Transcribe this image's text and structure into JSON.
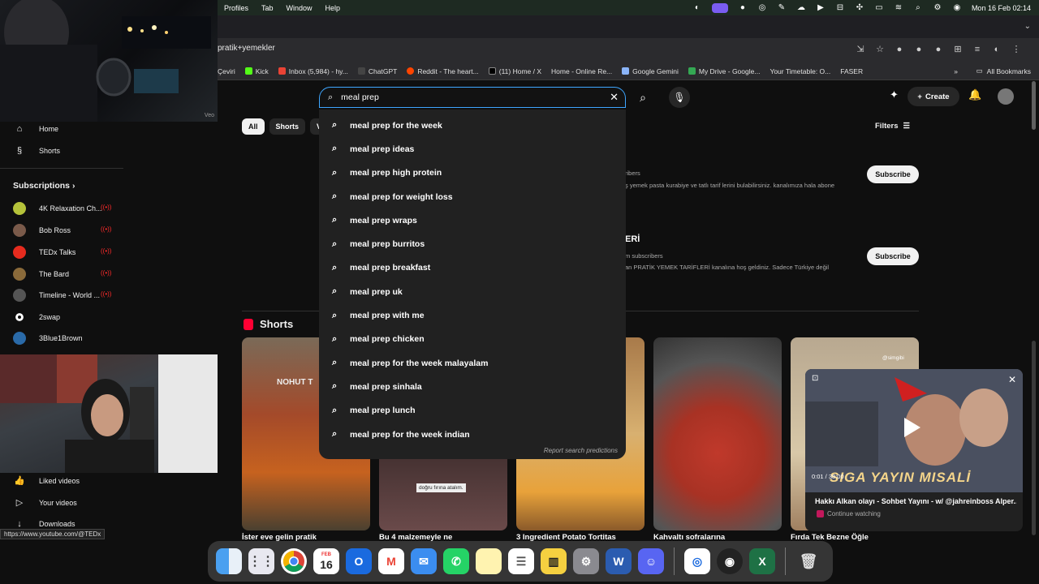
{
  "menubar": {
    "menus": [
      "Profiles",
      "Tab",
      "Window",
      "Help"
    ],
    "clock": "Mon 16 Feb  02:14"
  },
  "browser": {
    "url_fragment": "pratik+yemekler",
    "bookmarks": [
      {
        "label": "Çeviri",
        "color": "#4a8af4"
      },
      {
        "label": "Kick",
        "color": "#53fc18"
      },
      {
        "label": "Inbox (5,984) - hy...",
        "color": "#ea4335"
      },
      {
        "label": "ChatGPT",
        "color": "#444444"
      },
      {
        "label": "Reddit - The heart...",
        "color": "#ff4500"
      },
      {
        "label": "(11) Home / X",
        "color": "#000000"
      },
      {
        "label": "Home - Online Re...",
        "color": "#5b5b5b"
      },
      {
        "label": "Google Gemini",
        "color": "#8ab4f8"
      },
      {
        "label": "My Drive - Google...",
        "color": "#34a853"
      },
      {
        "label": "Your Timetable: O...",
        "color": "#666666"
      },
      {
        "label": "FASER",
        "color": "#777777"
      }
    ],
    "all_bookmarks": "All Bookmarks"
  },
  "search": {
    "query": "meal prep",
    "suggestions": [
      "meal prep for the week",
      "meal prep ideas",
      "meal prep high protein",
      "meal prep for weight loss",
      "meal prep wraps",
      "meal prep burritos",
      "meal prep breakfast",
      "meal prep uk",
      "meal prep with me",
      "meal prep chicken",
      "meal prep for the week malayalam",
      "meal prep sinhala",
      "meal prep lunch",
      "meal prep for the week indian"
    ],
    "report": "Report search predictions"
  },
  "header": {
    "create": "Create"
  },
  "chips": [
    "All",
    "Shorts",
    "V"
  ],
  "filters": "Filters",
  "channels": [
    {
      "meta": "ribers",
      "desc": "ş yemek pasta kurabiye ve tatlı tarif lerini bulabilirsiniz. kanalımıza hala abone",
      "subscribe": "Subscribe"
    },
    {
      "title": "ERİ",
      "meta": "m subscribers",
      "desc": "an PRATİK YEMEK TARİFLERİ kanalına hoş geldiniz. Sadece Türkiye değil",
      "subscribe": "Subscribe"
    }
  ],
  "shorts": {
    "heading": "Shorts",
    "items": [
      {
        "title": "İster eve gelin pratik",
        "overlay": "NOHUT T"
      },
      {
        "title": "Bu 4 malzemeyle ne",
        "overlay": "doğru fırına atalım."
      },
      {
        "title": "3 Ingredient Potato Tortitas",
        "overlay": ""
      },
      {
        "title": "Kahvaltı sofralarına",
        "overlay": ""
      },
      {
        "title": "Fırda Tek Bezne Öğle",
        "overlay": "@simgibi"
      }
    ]
  },
  "sidebar": {
    "main": [
      {
        "label": "Home",
        "icon": "home-icon"
      },
      {
        "label": "Shorts",
        "icon": "shorts-icon"
      }
    ],
    "subscriptions_label": "Subscriptions",
    "subscriptions": [
      {
        "label": "4K Relaxation Ch...",
        "color": "#b5c23a",
        "live": true
      },
      {
        "label": "Bob Ross",
        "color": "#7a5a4a",
        "live": true
      },
      {
        "label": "TEDx Talks",
        "color": "#e62b1e",
        "live": true
      },
      {
        "label": "The Bard",
        "color": "#8a6a3a",
        "live": true
      },
      {
        "label": "Timeline - World ...",
        "color": "#555555",
        "live": true
      },
      {
        "label": "2swap",
        "color": "#111111",
        "live": false
      },
      {
        "label": "3Blue1Brown",
        "color": "#2a6aa8",
        "live": false
      }
    ],
    "lower": [
      {
        "label": "Liked videos",
        "icon": "thumbs-up-icon"
      },
      {
        "label": "Your videos",
        "icon": "play-square-icon"
      },
      {
        "label": "Downloads",
        "icon": "download-icon"
      }
    ]
  },
  "cam_label": "Veo",
  "miniplayer": {
    "time": "0:01 / 38:00",
    "banner": "SIGA YAYIN MISALİ",
    "title": "Hakkı Alkan olayı - Sohbet Yayını - w/ @jahreinboss Alper...",
    "sub": "Continue watching"
  },
  "status_url": "https://www.youtube.com/@TEDx",
  "dock": {
    "calendar_month": "FEB",
    "calendar_day": "16"
  }
}
